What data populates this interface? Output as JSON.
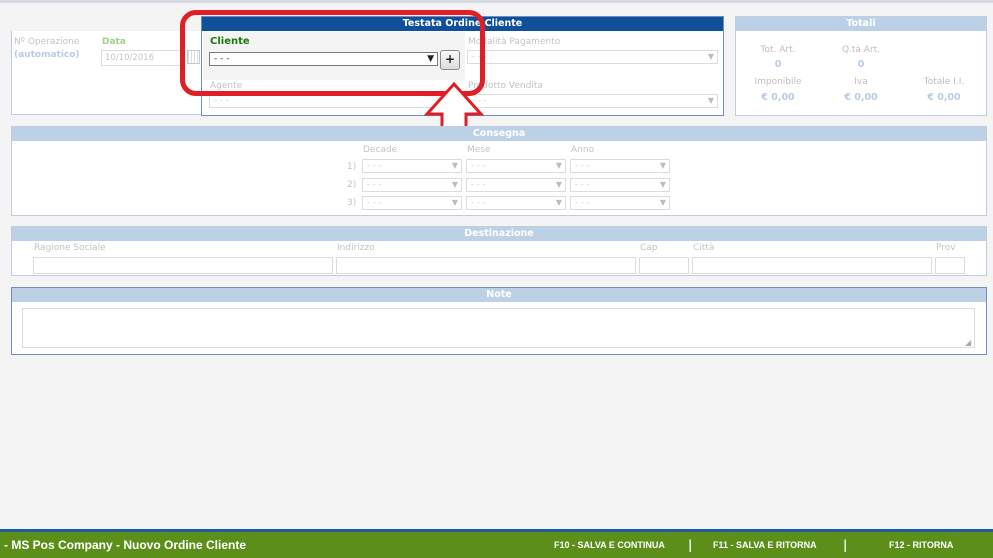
{
  "header": {
    "title": "Testata Ordine Cliente",
    "operazione_label": "Nº Operazione",
    "operazione_value": "(automatico)",
    "data_label": "Data",
    "data_value": "10/10/2016",
    "cliente_label": "Cliente",
    "cliente_value": "- - -",
    "add_label": "+",
    "agente_label": "Agente",
    "agente_value": "- - -",
    "modalita_label": "Modalità Pagamento",
    "modalita_value": "- - -",
    "prodotto_label": "Prodotto Vendita",
    "prodotto_value": "- - -"
  },
  "totali": {
    "title": "Totali",
    "tot_art_label": "Tot. Art.",
    "tot_art_value": "0",
    "qta_label": "Q.tà Art.",
    "qta_value": "0",
    "imponibile_label": "Imponibile",
    "imponibile_value": "€ 0,00",
    "iva_label": "Iva",
    "iva_value": "€ 0,00",
    "totale_label": "Totale I.I.",
    "totale_value": "€ 0,00"
  },
  "consegna": {
    "title": "Consegna",
    "col_decade": "Decade",
    "col_mese": "Mese",
    "col_anno": "Anno",
    "rows": [
      {
        "num": "1)",
        "decade": "- - -",
        "mese": "- - -",
        "anno": "- - -"
      },
      {
        "num": "2)",
        "decade": "- - -",
        "mese": "- - -",
        "anno": "- - -"
      },
      {
        "num": "3)",
        "decade": "- - -",
        "mese": "- - -",
        "anno": "- - -"
      }
    ]
  },
  "destinazione": {
    "title": "Destinazione",
    "ragione_label": "Ragione Sociale",
    "indirizzo_label": "Indirizzo",
    "cap_label": "Cap",
    "citta_label": "Città",
    "prov_label": "Prov"
  },
  "note": {
    "title": "Note"
  },
  "footer": {
    "title": "- MS Pos Company - Nuovo Ordine Cliente",
    "f10": "F10 - SALVA E CONTINUA",
    "f11": "F11 - SALVA E RITORNA",
    "f12": "F12 - RITORNA",
    "separator": "|"
  },
  "colors": {
    "highlight_red": "#e01e25",
    "header_blue": "#10509b",
    "footer_green": "#5b8f1a"
  }
}
